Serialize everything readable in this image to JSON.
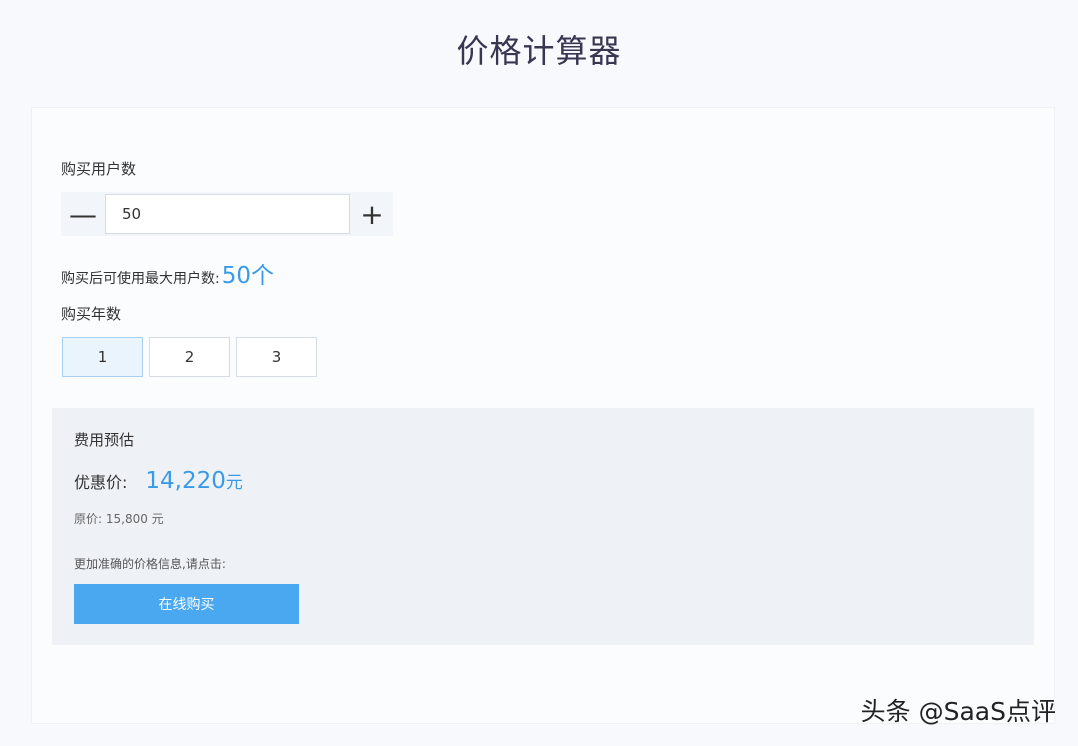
{
  "page_title": "价格计算器",
  "users": {
    "label": "购买用户数",
    "minus_glyph": "—",
    "plus_glyph": "+",
    "value": "50",
    "max_label": "购买后可使用最大用户数:",
    "max_value": "50个"
  },
  "years": {
    "label": "购买年数",
    "options": [
      "1",
      "2",
      "3"
    ],
    "selected": "1"
  },
  "estimate": {
    "title": "费用预估",
    "discount_label": "优惠价:",
    "discount_amount": "14,220",
    "discount_unit": "元",
    "original_text": "原价: 15,800 元",
    "hint": "更加准确的价格信息,请点击:",
    "buy_label": "在线购买"
  },
  "watermark": "头条 @SaaS点评",
  "colors": {
    "accent": "#3a9ae8",
    "button": "#4aa8f0",
    "selected_bg": "#eaf4fd"
  }
}
